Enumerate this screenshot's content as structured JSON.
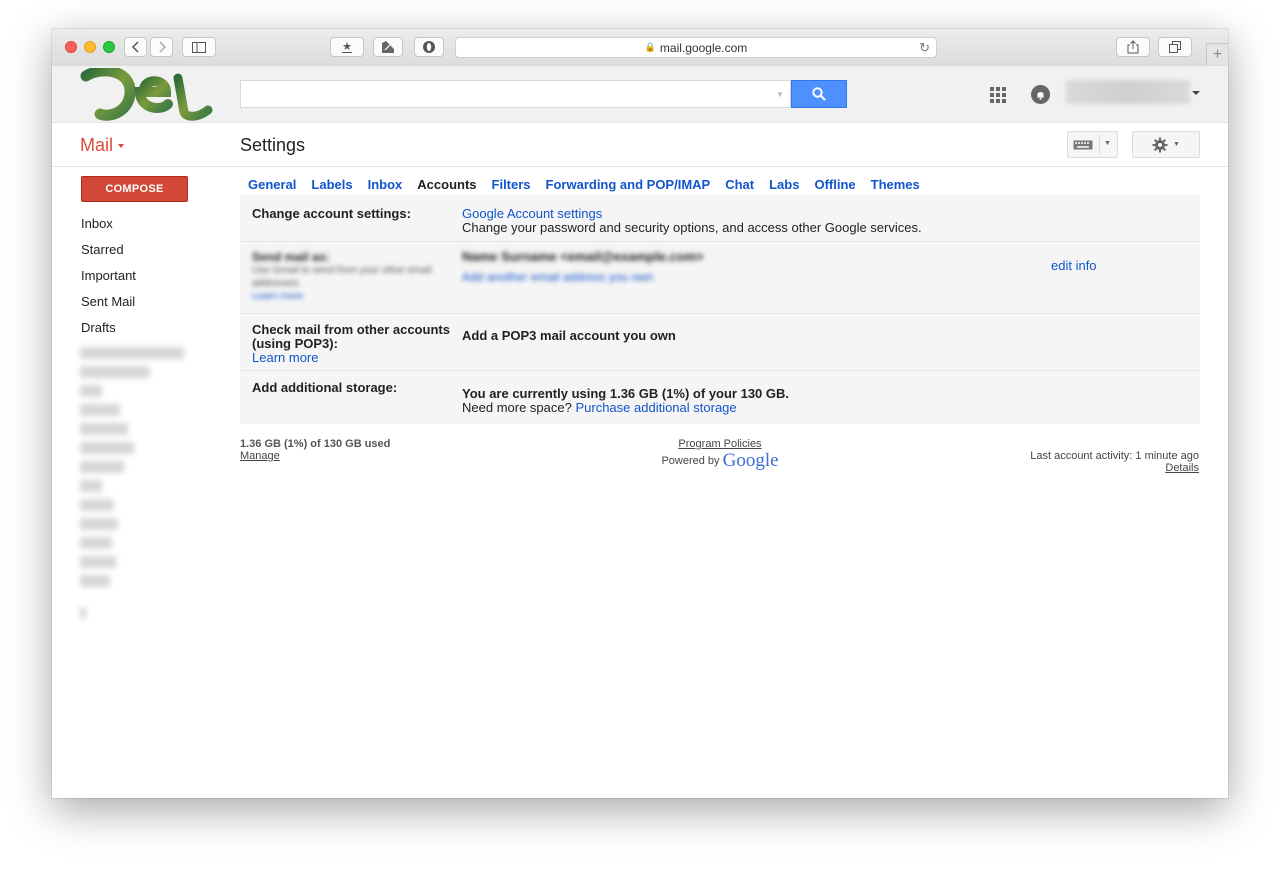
{
  "browser": {
    "url": "mail.google.com",
    "icons": [
      "back-chevron-icon",
      "forward-chevron-icon",
      "sidebar-icon",
      "bookmark-star-icon",
      "extension-icon",
      "circle-extension-icon",
      "lock-icon",
      "reload-icon",
      "share-icon",
      "tabs-icon",
      "new-tab-plus-icon"
    ]
  },
  "header": {
    "search_placeholder": "",
    "icons": [
      "search-icon",
      "apps-grid-icon",
      "notifications-bell-icon",
      "account-caret-icon"
    ]
  },
  "app": {
    "mail_label": "Mail",
    "page_title": "Settings"
  },
  "sidebar": {
    "compose_label": "COMPOSE",
    "items": [
      "Inbox",
      "Starred",
      "Important",
      "Sent Mail",
      "Drafts"
    ],
    "blurred_label_count": 14
  },
  "tabs": [
    {
      "label": "General",
      "active": false
    },
    {
      "label": "Labels",
      "active": false
    },
    {
      "label": "Inbox",
      "active": false
    },
    {
      "label": "Accounts",
      "active": true
    },
    {
      "label": "Filters",
      "active": false
    },
    {
      "label": "Forwarding and POP/IMAP",
      "active": false
    },
    {
      "label": "Chat",
      "active": false
    },
    {
      "label": "Labs",
      "active": false
    },
    {
      "label": "Offline",
      "active": false
    },
    {
      "label": "Themes",
      "active": false
    }
  ],
  "settings": {
    "change_account": {
      "label": "Change account settings:",
      "link": "Google Account settings",
      "desc": "Change your password and security options, and access other Google services."
    },
    "send_mail": {
      "label": "Send mail as:",
      "note": "Use Gmail to send from your other email addresses.",
      "learn": "Learn more",
      "value": "Name Surname <email@example.com>",
      "add_link": "Add another email address you own",
      "edit": "edit info"
    },
    "check_mail": {
      "label": "Check mail from other accounts (using POP3):",
      "learn": "Learn more",
      "link": "Add a POP3 mail account you own"
    },
    "storage": {
      "label": "Add additional storage:",
      "usage": "You are currently using 1.36 GB (1%) of your 130 GB.",
      "need": "Need more space?",
      "link": "Purchase additional storage"
    }
  },
  "footer": {
    "used": "1.36 GB (1%) of 130 GB used",
    "manage": "Manage",
    "policies": "Program Policies",
    "powered": "Powered by",
    "google": "Google",
    "activity": "Last account activity: 1 minute ago",
    "details": "Details"
  },
  "colors": {
    "accent_red": "#dd4b39",
    "compose_red": "#d14836",
    "link_blue": "#1155cc",
    "search_blue": "#4d90fe"
  }
}
